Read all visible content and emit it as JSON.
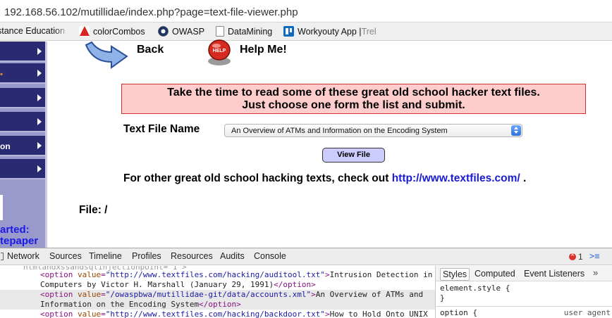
{
  "browser": {
    "url": "192.168.56.102/mutillidae/index.php?page=text-file-viewer.php",
    "bookmarks": [
      {
        "label": "stance Education ",
        "icon": "bookmark-icon"
      },
      {
        "label": "colorCombos",
        "icon": "adobe-icon"
      },
      {
        "label": "OWASP",
        "icon": "owasp-icon"
      },
      {
        "label": "DataMining",
        "icon": "page-icon"
      },
      {
        "label": "Workyouty App | ",
        "faded": "Trel",
        "icon": "trello-icon"
      }
    ]
  },
  "sidebar": {
    "items": [
      {
        "label": "",
        "orange": false
      },
      {
        "label": "",
        "orange": true
      },
      {
        "label": "",
        "orange": false
      },
      {
        "label": "",
        "orange": false
      },
      {
        "label": "on",
        "orange": false
      },
      {
        "label": "",
        "orange": false
      }
    ],
    "started_line1": "arted:",
    "started_line2": "tepaper"
  },
  "main": {
    "back_label": "Back",
    "help_label": "Help Me!",
    "info_line1": "Take the time to read some of these great old school hacker text files.",
    "info_line2": "Just choose one form the list and submit.",
    "text_file_label": "Text File Name",
    "selected_file": "An Overview of ATMs and Information on the Encoding System",
    "view_button": "View File",
    "other_prefix": "For other great old school hacking texts, check out ",
    "other_link": "http://www.textfiles.com/",
    "other_suffix": " .",
    "file_label": "File: /"
  },
  "devtools": {
    "tabs": [
      "Network",
      "Sources",
      "Timeline",
      "Profiles",
      "Resources",
      "Audits",
      "Console"
    ],
    "error_count": "1",
    "console_icon": "console-toggle-icon",
    "code": {
      "partial": "ntmlandxssandsqlinjectionpoint=\"1\">",
      "line1_value": "\"http://www.textfiles.com/hacking/auditool.txt\"",
      "line1_text": "Intrusion Detection in",
      "line2_text": "Computers by Victor H. Marshall (January 29, 1991)",
      "line3_value": "\"/owaspbwa/mutillidae-git/data/accounts.xml\"",
      "line3_text": "An Overview of ATMs and",
      "line4_text": "Information on the Encoding System",
      "line5_value": "\"http://www.textfiles.com/hacking/backdoor.txt\"",
      "line5_text": "How to Hold Onto UNIX"
    },
    "styles": {
      "tabs": [
        "Styles",
        "Computed",
        "Event Listeners"
      ],
      "more": "»",
      "element_style": "element.style {",
      "close_brace": "}",
      "option_rule": "option {",
      "user_agent": "user agent"
    }
  }
}
